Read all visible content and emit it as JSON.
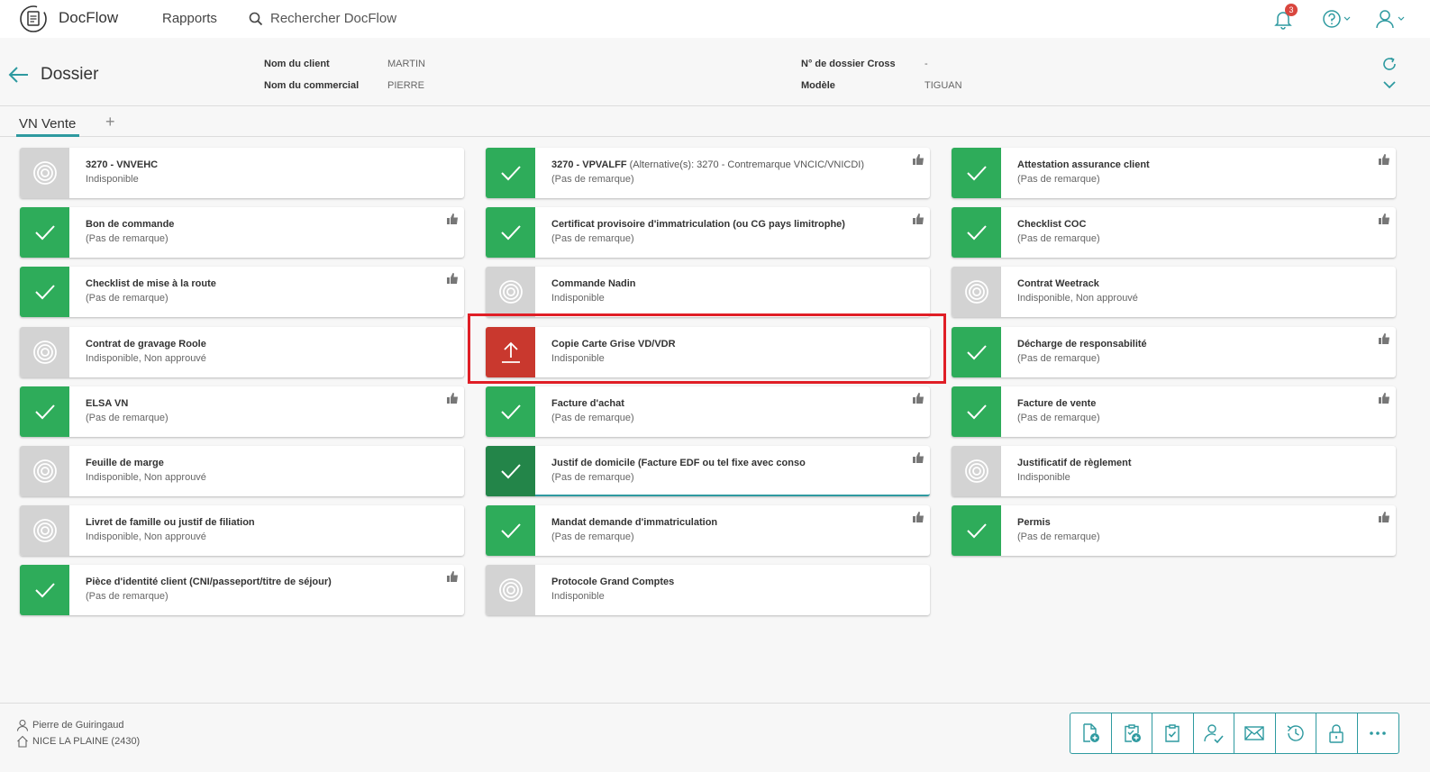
{
  "topbar": {
    "brand": "DocFlow",
    "nav_reports": "Rapports",
    "search_label": "Rechercher DocFlow",
    "notification_count": "3",
    "icons": [
      "docflow-logo-icon",
      "search-icon",
      "bell-icon",
      "help-icon",
      "user-icon"
    ]
  },
  "dossier": {
    "title": "Dossier",
    "fields": [
      {
        "label": "Nom du client",
        "value": "MARTIN"
      },
      {
        "label": "Nom du commercial",
        "value": "PIERRE"
      },
      {
        "label": "N° de dossier Cross",
        "value": "-"
      },
      {
        "label": "Modèle",
        "value": "TIGUAN"
      }
    ]
  },
  "tabs": {
    "active": "VN Vente",
    "add": "+"
  },
  "documents": [
    {
      "title": "3270 - VNVEHC",
      "alt": "",
      "subtitle": "Indisponible",
      "status": "na",
      "thumb": false
    },
    {
      "title": "3270 - VPVALFF",
      "alt": " (Alternative(s): 3270 - Contremarque VNCIC/VNICDI)",
      "subtitle": "(Pas de remarque)",
      "status": "ok",
      "thumb": true
    },
    {
      "title": "Attestation assurance client",
      "alt": "",
      "subtitle": "(Pas de remarque)",
      "status": "ok",
      "thumb": true
    },
    {
      "title": "Bon de commande",
      "alt": "",
      "subtitle": "(Pas de remarque)",
      "status": "ok",
      "thumb": true
    },
    {
      "title": "Certificat provisoire d'immatriculation (ou CG pays limitrophe)",
      "alt": "",
      "subtitle": "(Pas de remarque)",
      "status": "ok",
      "thumb": true
    },
    {
      "title": "Checklist COC",
      "alt": "",
      "subtitle": "(Pas de remarque)",
      "status": "ok",
      "thumb": true
    },
    {
      "title": "Checklist de mise à la route",
      "alt": "",
      "subtitle": "(Pas de remarque)",
      "status": "ok",
      "thumb": true
    },
    {
      "title": "Commande Nadin",
      "alt": "",
      "subtitle": "Indisponible",
      "status": "na",
      "thumb": false
    },
    {
      "title": "Contrat Weetrack",
      "alt": "",
      "subtitle": "Indisponible, Non approuvé",
      "status": "na",
      "thumb": false
    },
    {
      "title": "Contrat de gravage Roole",
      "alt": "",
      "subtitle": "Indisponible, Non approuvé",
      "status": "na",
      "thumb": false
    },
    {
      "title": "Copie Carte Grise VD/VDR",
      "alt": "",
      "subtitle": "Indisponible",
      "status": "upload",
      "thumb": false
    },
    {
      "title": "Décharge de responsabilité",
      "alt": "",
      "subtitle": "(Pas de remarque)",
      "status": "ok",
      "thumb": true
    },
    {
      "title": "ELSA VN",
      "alt": "",
      "subtitle": "(Pas de remarque)",
      "status": "ok",
      "thumb": true
    },
    {
      "title": "Facture d'achat",
      "alt": "",
      "subtitle": "(Pas de remarque)",
      "status": "ok",
      "thumb": true
    },
    {
      "title": "Facture de vente",
      "alt": "",
      "subtitle": "(Pas de remarque)",
      "status": "ok",
      "thumb": true
    },
    {
      "title": "Feuille de marge",
      "alt": "",
      "subtitle": "Indisponible, Non approuvé",
      "status": "na",
      "thumb": false
    },
    {
      "title": "Justif de domicile (Facture EDF ou tel fixe avec conso",
      "alt": "",
      "subtitle": "(Pas de remarque)",
      "status": "ok-dark",
      "thumb": true
    },
    {
      "title": "Justificatif de règlement",
      "alt": "",
      "subtitle": "Indisponible",
      "status": "na",
      "thumb": false
    },
    {
      "title": "Livret de famille ou justif de filiation",
      "alt": "",
      "subtitle": "Indisponible, Non approuvé",
      "status": "na",
      "thumb": false
    },
    {
      "title": "Mandat demande d'immatriculation",
      "alt": "",
      "subtitle": "(Pas de remarque)",
      "status": "ok",
      "thumb": true
    },
    {
      "title": "Permis",
      "alt": "",
      "subtitle": "(Pas de remarque)",
      "status": "ok",
      "thumb": true
    },
    {
      "title": "Pièce d'identité client (CNI/passeport/titre de séjour)",
      "alt": "",
      "subtitle": "(Pas de remarque)",
      "status": "ok",
      "thumb": true
    },
    {
      "title": "Protocole Grand Comptes",
      "alt": "",
      "subtitle": "Indisponible",
      "status": "na",
      "thumb": false
    }
  ],
  "footer": {
    "user": "Pierre de Guiringaud",
    "site": "NICE LA PLAINE (2430)",
    "tools": [
      "add-document-icon",
      "add-clipboard-icon",
      "checklist-icon",
      "user-check-icon",
      "mail-icon",
      "history-icon",
      "lock-icon",
      "more-icon"
    ]
  },
  "colors": {
    "ok": "#2eac5a",
    "ok_dark": "#238549",
    "unavailable": "#d3d3d3",
    "upload": "#c9382e",
    "accent": "#2e9aa0",
    "highlight": "#e01e26"
  }
}
